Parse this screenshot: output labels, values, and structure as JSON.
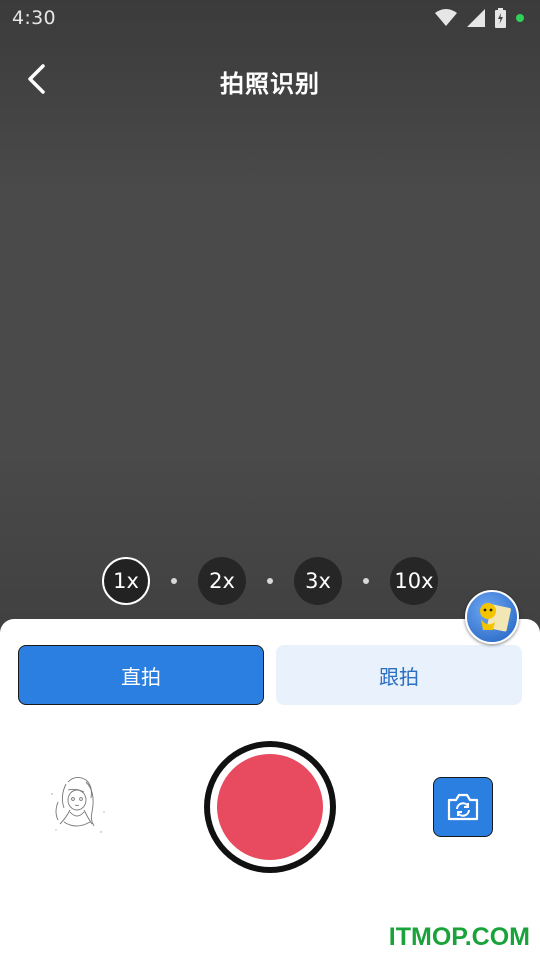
{
  "status_bar": {
    "time": "4:30"
  },
  "header": {
    "title": "拍照识别"
  },
  "zoom": {
    "options": [
      {
        "label": "1x",
        "active": true
      },
      {
        "label": "2x",
        "active": false
      },
      {
        "label": "3x",
        "active": false
      },
      {
        "label": "10x",
        "active": false
      }
    ]
  },
  "modes": {
    "direct": "直拍",
    "follow": "跟拍"
  },
  "colors": {
    "accent": "#2b7fe0",
    "shutter": "#e84a5f",
    "watermark": "#1aa33a"
  },
  "icons": {
    "back": "chevron-left-icon",
    "flip_camera": "camera-flip-icon",
    "mascot": "mascot-icon"
  },
  "watermark": "ITMOP.COM"
}
